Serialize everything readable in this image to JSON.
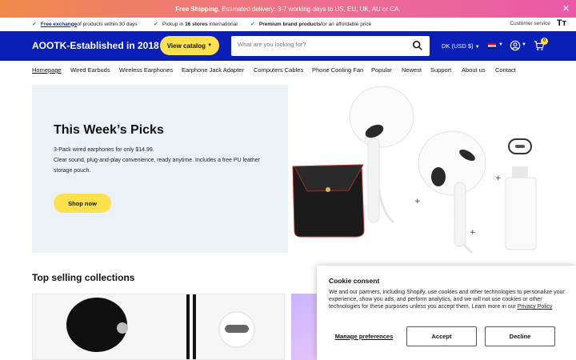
{
  "announcement": {
    "bold": "Free Shipping",
    "text": ", Estimated delivery: 3-7 working days to US, EU, UK, AU or CA."
  },
  "usp": {
    "item1_link": "Free exchange",
    "item1_rest": " of products within 30 days",
    "item2_pre": "Pickup in ",
    "item2_bold": "16 stores",
    "item2_rest": " international",
    "item3_bold": "Premium brand products",
    "item3_rest": " for an affordable price",
    "customer_service": "Customer service",
    "text_size_icon": "Tт"
  },
  "header": {
    "logo": "AOOTK-Established in 2018",
    "catalog_button": "View catalog",
    "search_placeholder": "What are you looking for?",
    "currency": "DK (USD $)",
    "cart_count": "0"
  },
  "nav": {
    "items": [
      "Homepage",
      "Wired Earbuds",
      "Wireless Earphones",
      "Earphone Jack Adapter",
      "Computers Cables",
      "Phone Cooling Fan",
      "Popular",
      "Newest",
      "Support",
      "About us",
      "Contact"
    ]
  },
  "hero": {
    "title": "This Week’s Picks",
    "line1": "3-Pack wired earphones for only $14.99.",
    "line2": "Clear sound, plug-and-play convenience, ready anytime. Includes a free PU leather storage pouch.",
    "button": "Shop now"
  },
  "collections": {
    "title": "Top selling collections"
  },
  "cookie": {
    "title": "Cookie consent",
    "text": "We and our partners, including Shopify, use cookies and other technologies to personalize your experience, show you ads, and perform analytics, and we will not use cookies or other technologies for these purposes unless you accept them. Learn more in our ",
    "link": "Privacy Policy",
    "manage": "Manage preferences",
    "accept": "Accept",
    "decline": "Decline"
  },
  "colors": {
    "header_blue": "#0a1fb5",
    "accent_yellow": "#ffe14d",
    "hero_bg": "#eaf2f8"
  }
}
